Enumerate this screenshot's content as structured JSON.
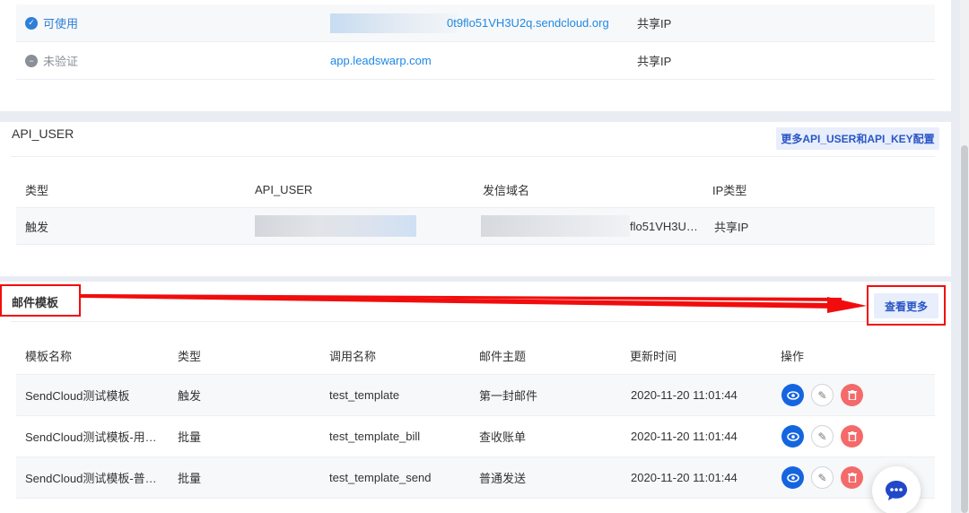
{
  "domains": {
    "rows": [
      {
        "status": "可使用",
        "status_type": "ok",
        "domain": "0t9flo51VH3U2q.sendcloud.org",
        "ip_type": "共享IP"
      },
      {
        "status": "未验证",
        "status_type": "pending",
        "domain": "app.leadswarp.com",
        "ip_type": "共享IP"
      }
    ]
  },
  "api_user": {
    "title": "API_USER",
    "more_button": "更多API_USER和API_KEY配置",
    "headers": {
      "type": "类型",
      "api_user": "API_USER",
      "domain": "发信域名",
      "ip_type": "IP类型"
    },
    "rows": [
      {
        "type": "触发",
        "api_user": "",
        "domain": "flo51VH3U…",
        "ip_type": "共享IP"
      }
    ]
  },
  "templates": {
    "title": "邮件模板",
    "view_more_button": "查看更多",
    "headers": {
      "name": "模板名称",
      "type": "类型",
      "call_name": "调用名称",
      "subject": "邮件主题",
      "updated": "更新时间",
      "actions": "操作"
    },
    "rows": [
      {
        "name": "SendCloud测试模板",
        "type": "触发",
        "call_name": "test_template",
        "subject": "第一封邮件",
        "updated": "2020-11-20 11:01:44"
      },
      {
        "name": "SendCloud测试模板-用…",
        "type": "批量",
        "call_name": "test_template_bill",
        "subject": "查收账单",
        "updated": "2020-11-20 11:01:44"
      },
      {
        "name": "SendCloud测试模板-普…",
        "type": "批量",
        "call_name": "test_template_send",
        "subject": "普通发送",
        "updated": "2020-11-20 11:01:44"
      }
    ]
  },
  "icons": {
    "check": "check-circle-icon",
    "pending": "pending-circle-icon",
    "view": "eye-icon",
    "edit": "pencil-icon",
    "delete": "trash-icon",
    "chat": "chat-bubble-icon"
  },
  "colors": {
    "primary": "#1565e0",
    "link": "#1e88e5",
    "danger": "#f46a6a",
    "annotation": "#f10d0d"
  }
}
